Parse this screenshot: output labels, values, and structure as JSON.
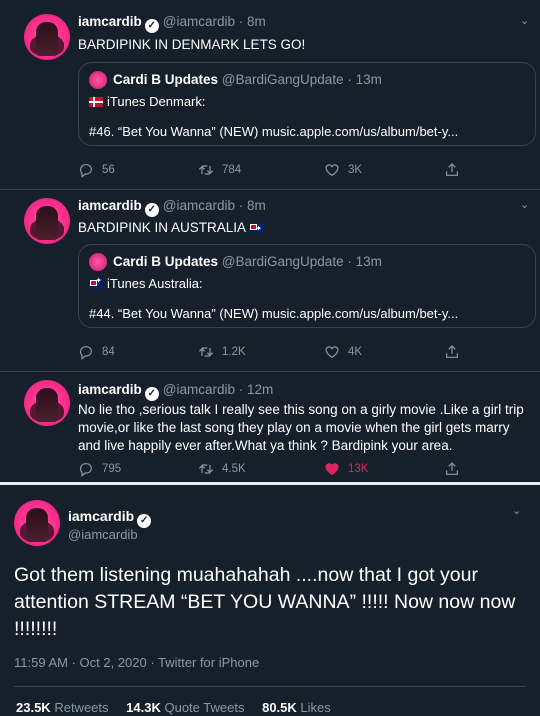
{
  "tweets": [
    {
      "name": "iamcardib",
      "handle": "@iamcardib",
      "time": "· 8m",
      "text": "BARDIPINK IN DENMARK LETS GO!",
      "quote": {
        "name": "Cardi B Updates",
        "handle": "@BardiGangUpdate",
        "time": "· 13m",
        "line1": "iTunes Denmark:",
        "line2": "#46. “Bet You Wanna” (NEW) music.apple.com/us/album/bet-y..."
      },
      "replies": "56",
      "retweets": "784",
      "likes": "3K"
    },
    {
      "name": "iamcardib",
      "handle": "@iamcardib",
      "time": "· 8m",
      "text": "BARDIPINK IN AUSTRALIA",
      "quote": {
        "name": "Cardi B Updates",
        "handle": "@BardiGangUpdate",
        "time": "· 13m",
        "line1": "iTunes Australia:",
        "line2": "#44. “Bet You Wanna” (NEW) music.apple.com/us/album/bet-y..."
      },
      "replies": "84",
      "retweets": "1.2K",
      "likes": "4K"
    },
    {
      "name": "iamcardib",
      "handle": "@iamcardib",
      "time": "· 12m",
      "text": "No lie tho ,serious talk I really see this song on a girly movie .Like a girl trip movie,or like the last song they play on a movie when the girl gets marry and live happily ever after.What ya think ? Bardipink your area.",
      "replies": "795",
      "retweets": "4.5K",
      "likes": "13K",
      "liked": true
    }
  ],
  "main": {
    "name": "iamcardib",
    "handle": "@iamcardib",
    "text": "Got them listening muahahahah ....now that I got your attention STREAM “BET YOU WANNA” !!!!! Now now now !!!!!!!!",
    "meta": "11:59 AM · Oct 2, 2020 · Twitter for iPhone",
    "retweets_count": "23.5K",
    "retweets_label": "Retweets",
    "quotes_count": "14.3K",
    "quotes_label": "Quote Tweets",
    "likes_count": "80.5K",
    "likes_label": "Likes"
  },
  "colors": {
    "background": "#15202b",
    "border": "#38444d",
    "secondary_text": "#8899a6",
    "like": "#e0245e"
  },
  "icons": [
    "verified-badge-icon",
    "chevron-down-icon",
    "reply-icon",
    "retweet-icon",
    "like-icon",
    "share-icon",
    "flag-denmark-icon",
    "flag-australia-icon"
  ]
}
